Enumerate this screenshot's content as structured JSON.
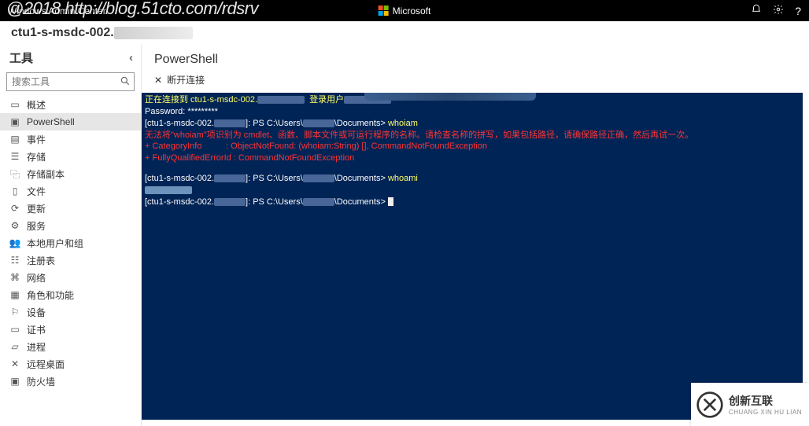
{
  "watermark": "@2018 http://blog.51cto.com/rdsrv",
  "topbar": {
    "product": "Windows Admin Center",
    "brand": "Microsoft"
  },
  "host": "ctu1-s-msdc-002.",
  "sidebar": {
    "title": "工具",
    "search_placeholder": "搜索工具",
    "items": [
      {
        "icon": "overview",
        "label": "概述"
      },
      {
        "icon": "powershell",
        "label": "PowerShell"
      },
      {
        "icon": "calendar",
        "label": "事件"
      },
      {
        "icon": "storage",
        "label": "存储"
      },
      {
        "icon": "replica",
        "label": "存储副本"
      },
      {
        "icon": "file",
        "label": "文件"
      },
      {
        "icon": "update",
        "label": "更新"
      },
      {
        "icon": "services",
        "label": "服务"
      },
      {
        "icon": "users",
        "label": "本地用户和组"
      },
      {
        "icon": "registry",
        "label": "注册表"
      },
      {
        "icon": "network",
        "label": "网络"
      },
      {
        "icon": "roles",
        "label": "角色和功能"
      },
      {
        "icon": "device",
        "label": "设备"
      },
      {
        "icon": "cert",
        "label": "证书"
      },
      {
        "icon": "process",
        "label": "进程"
      },
      {
        "icon": "remote",
        "label": "远程桌面"
      },
      {
        "icon": "firewall",
        "label": "防火墙"
      }
    ],
    "active_index": 1
  },
  "content": {
    "title": "PowerShell",
    "disconnect": "断开连接"
  },
  "terminal": {
    "line1_a": "正在连接到 ctu1-s-msdc-002.",
    "line1_b": "登录用户",
    "line2": "Password: *********",
    "prompt_host": "[ctu1-s-msdc-002.",
    "prompt_mid": "]: PS C:\\Users\\",
    "prompt_end": "\\Documents>",
    "cmd1": "whoiam",
    "err1": "无法将\"whoiam\"项识别为 cmdlet、函数、脚本文件或可运行程序的名称。请检查名称的拼写，如果包括路径，请确保路径正确，然后再试一次。",
    "err2a": "    + CategoryInfo",
    "err2b": ": ObjectNotFound: (whoiam:String) [], CommandNotFoundException",
    "err3a": "    + FullyQualifiedErrorId : CommandNotFoundException",
    "cmd2": "whoami"
  },
  "badge": {
    "name": "创新互联",
    "sub": "CHUANG XIN HU LIAN"
  }
}
